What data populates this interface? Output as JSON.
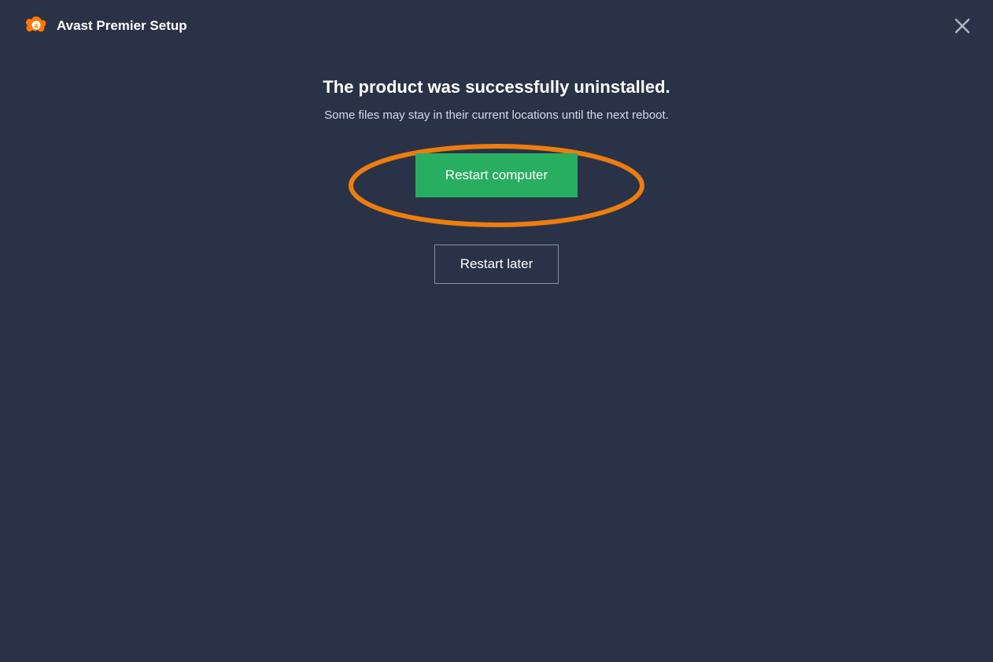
{
  "header": {
    "app_title": "Avast Premier Setup"
  },
  "content": {
    "heading": "The product was successfully uninstalled.",
    "subtext": "Some files may stay in their current locations until the next reboot.",
    "primary_button": "Restart computer",
    "secondary_button": "Restart later"
  },
  "colors": {
    "background": "#2a3248",
    "primary_button": "#27ae60",
    "highlight": "#ed7d0e",
    "logo": "#ff7800"
  }
}
